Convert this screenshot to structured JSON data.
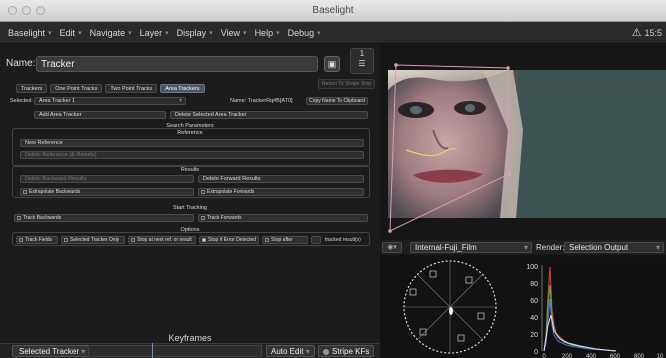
{
  "window": {
    "title": "Baselight"
  },
  "menubar": {
    "items": [
      "Baselight",
      "Edit",
      "Navigate",
      "Layer",
      "Display",
      "View",
      "Help",
      "Debug"
    ],
    "warning_text": "15:5"
  },
  "layer": {
    "name_label": "Name:",
    "name_value": "Tracker",
    "stack_number": "1"
  },
  "tabs": {
    "items": [
      "Trackers",
      "One Point Tracks",
      "Two Point Tracks",
      "Area Trackers"
    ],
    "active": "Area Trackers",
    "return_label": "Return To Shape Strip"
  },
  "tracker": {
    "selected_label": "Selected:",
    "selected_value": "Area Tracker 1",
    "name_text": "Name: TrackerRq#B[AT0]",
    "copy_name": "Copy Name To Clipboard",
    "add_area": "Add Area Tracker",
    "delete_selected": "Delete Selected Area Tracker"
  },
  "search": {
    "title": "Search Parameters",
    "reference_title": "Reference",
    "new_reference": "New Reference",
    "delete_reference": "Delete Reference (& Results)"
  },
  "results": {
    "title": "Results",
    "delete_backward": "Delete Backward Results",
    "delete_forward": "Delete Forward Results",
    "extrapolate_backwards": "Extrapolate Backwards",
    "extrapolate_forwards": "Extrapolate Forwards"
  },
  "start_tracking": {
    "title": "Start Tracking",
    "track_backwards": "Track Backwards",
    "track_forwards": "Track Forwards"
  },
  "options": {
    "title": "Options",
    "items": [
      "Track Fields",
      "Selected Tracker Only",
      "Stop at next ref. or result",
      "Stop if Error Detected",
      "Stop after",
      "tracked result(s)"
    ]
  },
  "keyframes": {
    "title": "Keyframes",
    "selected_tracker": "Selected Tracker",
    "auto_edit": "Auto Edit",
    "stripe_kfs": "Stripe KFs"
  },
  "viewer": {
    "colour_space": "Internal-Fuji_Film",
    "render_label": "Render:",
    "render_value": "Selection Output"
  },
  "histogram": {
    "y_ticks": [
      "100",
      "80",
      "60",
      "40",
      "20",
      "0"
    ],
    "x_ticks": [
      "0",
      "200",
      "400",
      "600",
      "800",
      "10"
    ]
  }
}
